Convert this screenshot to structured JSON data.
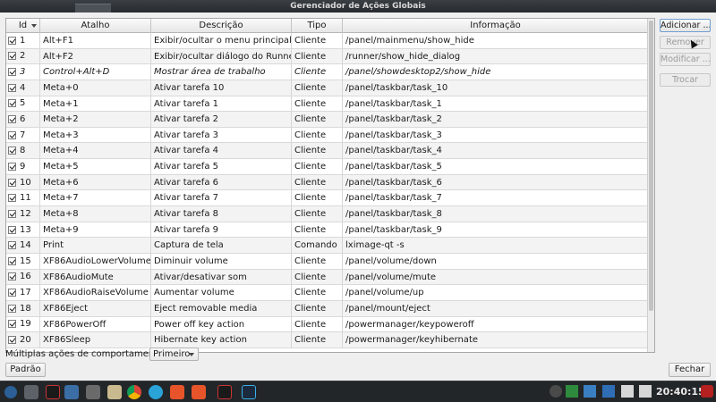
{
  "window": {
    "title": "Gerenciador de Ações Globais"
  },
  "table": {
    "columns": [
      "Id",
      "Atalho",
      "Descrição",
      "Tipo",
      "Informação"
    ],
    "rows": [
      {
        "id": "1",
        "shortcut": "Alt+F1",
        "description": "Exibir/ocultar o menu principal",
        "type": "Cliente",
        "info": "/panel/mainmenu/show_hide",
        "italic": false
      },
      {
        "id": "2",
        "shortcut": "Alt+F2",
        "description": "Exibir/ocultar diálogo do Runner",
        "type": "Cliente",
        "info": "/runner/show_hide_dialog",
        "italic": false
      },
      {
        "id": "3",
        "shortcut": "Control+Alt+D",
        "description": "Mostrar área de trabalho",
        "type": "Cliente",
        "info": "/panel/showdesktop2/show_hide",
        "italic": true
      },
      {
        "id": "4",
        "shortcut": "Meta+0",
        "description": "Ativar tarefa 10",
        "type": "Cliente",
        "info": "/panel/taskbar/task_10",
        "italic": false
      },
      {
        "id": "5",
        "shortcut": "Meta+1",
        "description": "Ativar tarefa 1",
        "type": "Cliente",
        "info": "/panel/taskbar/task_1",
        "italic": false
      },
      {
        "id": "6",
        "shortcut": "Meta+2",
        "description": "Ativar tarefa 2",
        "type": "Cliente",
        "info": "/panel/taskbar/task_2",
        "italic": false
      },
      {
        "id": "7",
        "shortcut": "Meta+3",
        "description": "Ativar tarefa 3",
        "type": "Cliente",
        "info": "/panel/taskbar/task_3",
        "italic": false
      },
      {
        "id": "8",
        "shortcut": "Meta+4",
        "description": "Ativar tarefa 4",
        "type": "Cliente",
        "info": "/panel/taskbar/task_4",
        "italic": false
      },
      {
        "id": "9",
        "shortcut": "Meta+5",
        "description": "Ativar tarefa 5",
        "type": "Cliente",
        "info": "/panel/taskbar/task_5",
        "italic": false
      },
      {
        "id": "10",
        "shortcut": "Meta+6",
        "description": "Ativar tarefa 6",
        "type": "Cliente",
        "info": "/panel/taskbar/task_6",
        "italic": false
      },
      {
        "id": "11",
        "shortcut": "Meta+7",
        "description": "Ativar tarefa 7",
        "type": "Cliente",
        "info": "/panel/taskbar/task_7",
        "italic": false
      },
      {
        "id": "12",
        "shortcut": "Meta+8",
        "description": "Ativar tarefa 8",
        "type": "Cliente",
        "info": "/panel/taskbar/task_8",
        "italic": false
      },
      {
        "id": "13",
        "shortcut": "Meta+9",
        "description": "Ativar tarefa 9",
        "type": "Cliente",
        "info": "/panel/taskbar/task_9",
        "italic": false
      },
      {
        "id": "14",
        "shortcut": "Print",
        "description": "Captura de tela",
        "type": "Comando",
        "info": "lximage-qt -s",
        "italic": false
      },
      {
        "id": "15",
        "shortcut": "XF86AudioLowerVolume",
        "description": "Diminuir volume",
        "type": "Cliente",
        "info": "/panel/volume/down",
        "italic": false
      },
      {
        "id": "16",
        "shortcut": "XF86AudioMute",
        "description": "Ativar/desativar som",
        "type": "Cliente",
        "info": "/panel/volume/mute",
        "italic": false
      },
      {
        "id": "17",
        "shortcut": "XF86AudioRaiseVolume",
        "description": "Aumentar volume",
        "type": "Cliente",
        "info": "/panel/volume/up",
        "italic": false
      },
      {
        "id": "18",
        "shortcut": "XF86Eject",
        "description": "Eject removable media",
        "type": "Cliente",
        "info": "/panel/mount/eject",
        "italic": false
      },
      {
        "id": "19",
        "shortcut": "XF86PowerOff",
        "description": "Power off key action",
        "type": "Cliente",
        "info": "/powermanager/keypoweroff",
        "italic": false
      },
      {
        "id": "20",
        "shortcut": "XF86Sleep",
        "description": "Hibernate key action",
        "type": "Cliente",
        "info": "/powermanager/keyhibernate",
        "italic": false
      }
    ]
  },
  "side_buttons": [
    {
      "key": "add",
      "label": "Adicionar ...",
      "enabled": true
    },
    {
      "key": "remove",
      "label": "Remover",
      "enabled": false
    },
    {
      "key": "modify",
      "label": "Modificar ...",
      "enabled": false
    },
    {
      "key": "swap",
      "label": "Trocar",
      "enabled": false
    }
  ],
  "behavior": {
    "label": "Múltiplas ações de comportamento:",
    "selected": "Primeiro"
  },
  "footer": {
    "default_label": "Padrão",
    "close_label": "Fechar"
  },
  "taskbar": {
    "clock": "20:40:15"
  },
  "colors": {
    "accent": "#3daee9",
    "window_bg": "#efefef",
    "taskbar_bg": "#232629"
  }
}
